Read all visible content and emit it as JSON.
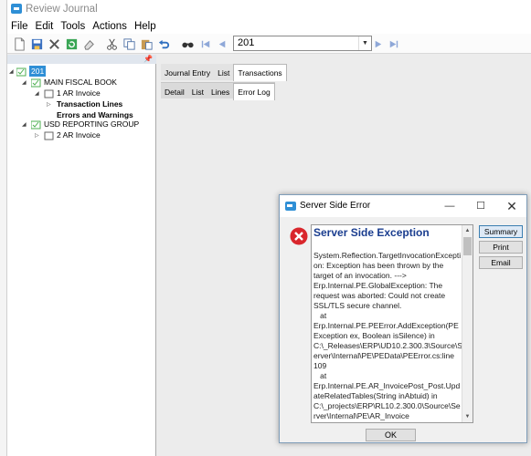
{
  "window": {
    "title": "Review Journal"
  },
  "menu": [
    "File",
    "Edit",
    "Tools",
    "Actions",
    "Help"
  ],
  "toolbar": {
    "journal_value": "201"
  },
  "tree": {
    "root": "201",
    "book1": "MAIN FISCAL BOOK",
    "book1_child": "1 AR Invoice",
    "book1_sub1": "Transaction Lines",
    "book1_sub2": "Errors and Warnings",
    "book2": "USD REPORTING GROUP",
    "book2_child": "2 AR Invoice"
  },
  "tabs_top": [
    "Journal Entry",
    "List",
    "Transactions"
  ],
  "tabs_bottom": [
    "Detail",
    "List",
    "Lines",
    "Error Log"
  ],
  "dialog": {
    "title": "Server Side Error",
    "heading": "Server Side Exception",
    "message": "System.Reflection.TargetInvocationException: Exception has been thrown by the target of an invocation. --->\nErp.Internal.PE.GlobalException: The request was aborted: Could not create SSL/TLS secure channel.\n   at\nErp.Internal.PE.PEError.AddException(PEException ex, Boolean isSilence) in C:\\_Releases\\ERP\\UD10.2.300.3\\Source\\Server\\Internal\\PE\\PEData\\PEError.cs:line 109\n   at\nErp.Internal.PE.AR_InvoicePost_Post.UpdateRelatedTables(String inAbtuid) in C:\\_projects\\ERP\\RL10.2.300.0\\Source\\Server\\Internal\\PE\\AR_Invoice",
    "buttons": [
      "Summary",
      "Print",
      "Email"
    ],
    "ok": "OK"
  },
  "colors": {
    "accent": "#2f8fd6",
    "error": "#d9262c",
    "heading": "#1a3d8f"
  }
}
